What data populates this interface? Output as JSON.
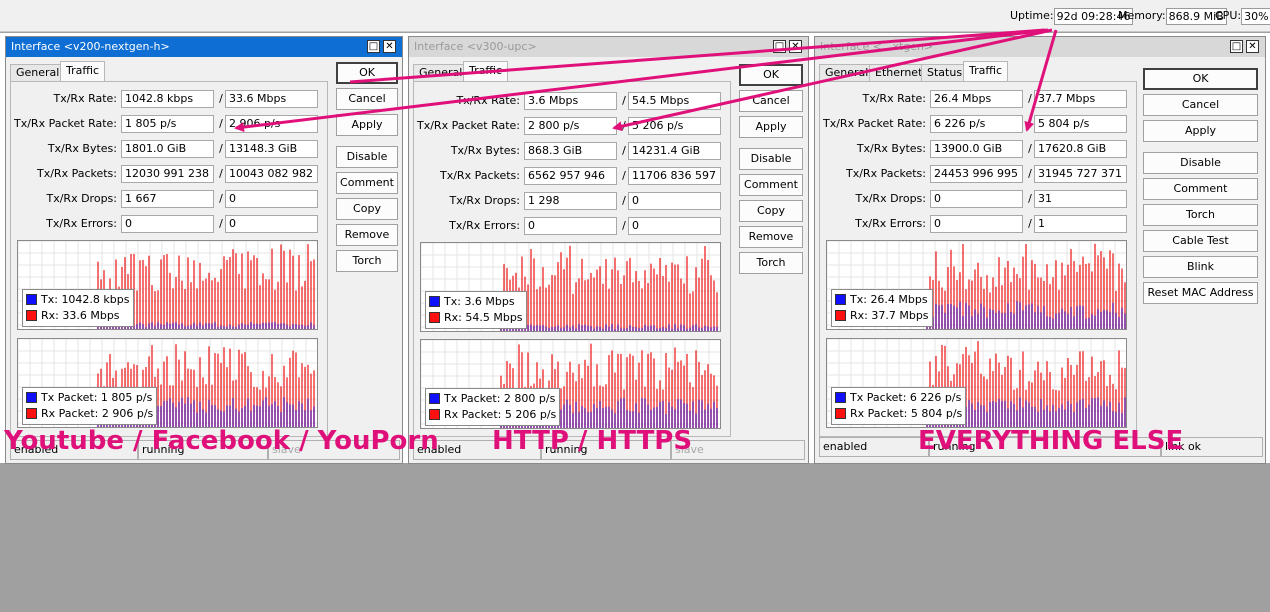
{
  "topbar": {
    "uptime_label": "Uptime:",
    "uptime_value": "92d 09:28:46",
    "memory_label": "Memory:",
    "memory_value": "868.9 MiB",
    "cpu_label": "CPU:",
    "cpu_value": "30%"
  },
  "field_labels": {
    "rate": "Tx/Rx Rate:",
    "packet_rate": "Tx/Rx Packet Rate:",
    "bytes": "Tx/Rx Bytes:",
    "packets": "Tx/Rx Packets:",
    "drops": "Tx/Rx Drops:",
    "errors": "Tx/Rx Errors:",
    "slash": "/"
  },
  "legend_labels": {
    "tx": "Tx:",
    "rx": "Rx:",
    "tx_packet": "Tx Packet:",
    "rx_packet": "Rx Packet:"
  },
  "colors": {
    "accent": "#e0107a",
    "tx": "#1010ff",
    "rx": "#ff1010",
    "title_active": "#0e6ed4"
  },
  "windows": [
    {
      "title": "Interface <v200-nextgen-h>",
      "tabs": [
        "General",
        "Traffic"
      ],
      "rate": [
        "1042.8 kbps",
        "33.6 Mbps"
      ],
      "packet_rate": [
        "1 805 p/s",
        "2 906 p/s"
      ],
      "bytes": [
        "1801.0 GiB",
        "13148.3 GiB"
      ],
      "packets": [
        "12030 991 238",
        "10043 082 982"
      ],
      "drops": [
        "1 667",
        "0"
      ],
      "errors": [
        "0",
        "0"
      ],
      "buttons": [
        "OK",
        "Cancel",
        "Apply",
        "Disable",
        "Comment",
        "Copy",
        "Remove",
        "Torch"
      ],
      "legend_tx": "1042.8 kbps",
      "legend_rx": "33.6 Mbps",
      "legend_tx_packet": "1 805 p/s",
      "legend_rx_packet": "2 906 p/s",
      "status": [
        "enabled",
        "running",
        "slave"
      ],
      "caption": "Youtube / Facebook / YouPorn"
    },
    {
      "title": "Interface <v300-upc>",
      "tabs": [
        "General",
        "Traffic"
      ],
      "rate": [
        "3.6 Mbps",
        "54.5 Mbps"
      ],
      "packet_rate": [
        "2 800 p/s",
        "5 206 p/s"
      ],
      "bytes": [
        "868.3 GiB",
        "14231.4 GiB"
      ],
      "packets": [
        "6562 957 946",
        "11706 836 597"
      ],
      "drops": [
        "1 298",
        "0"
      ],
      "errors": [
        "0",
        "0"
      ],
      "buttons": [
        "OK",
        "Cancel",
        "Apply",
        "Disable",
        "Comment",
        "Copy",
        "Remove",
        "Torch"
      ],
      "legend_tx": "3.6 Mbps",
      "legend_rx": "54.5 Mbps",
      "legend_tx_packet": "2 800 p/s",
      "legend_rx_packet": "5 206 p/s",
      "status": [
        "enabled",
        "running",
        "slave"
      ],
      "caption": "HTTP / HTTPS"
    },
    {
      "title": "Interface <...xtgen>",
      "tabs": [
        "General",
        "Ethernet",
        "Status",
        "Traffic"
      ],
      "rate": [
        "26.4 Mbps",
        "37.7 Mbps"
      ],
      "packet_rate": [
        "6 226 p/s",
        "5 804 p/s"
      ],
      "bytes": [
        "13900.0 GiB",
        "17620.8 GiB"
      ],
      "packets": [
        "24453 996 995",
        "31945 727 371"
      ],
      "drops": [
        "0",
        "31"
      ],
      "errors": [
        "0",
        "1"
      ],
      "buttons": [
        "OK",
        "Cancel",
        "Apply",
        "Disable",
        "Comment",
        "Torch",
        "Cable Test",
        "Blink",
        "Reset MAC Address"
      ],
      "legend_tx": "26.4 Mbps",
      "legend_rx": "37.7 Mbps",
      "legend_tx_packet": "6 226 p/s",
      "legend_rx_packet": "5 804 p/s",
      "status": [
        "enabled",
        "running",
        "link ok"
      ],
      "caption": "EVERYTHING ELSE"
    }
  ]
}
